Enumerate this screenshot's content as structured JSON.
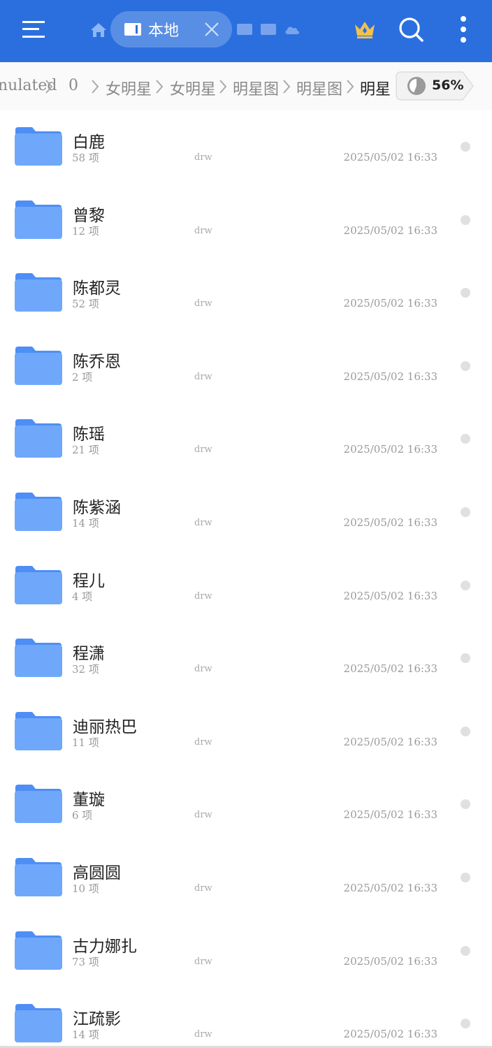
{
  "toolbar": {
    "active_tab_label": "本地",
    "icons": [
      "menu-icon",
      "home-icon",
      "device-icon",
      "close-icon",
      "vip-crown-icon",
      "search-icon",
      "more-vertical-icon"
    ]
  },
  "breadcrumb": {
    "items": [
      "nulated",
      "0",
      "女明星",
      "女明星",
      "明星图",
      "明星图",
      "明星"
    ]
  },
  "storage": {
    "percent_label": "56%",
    "percent": 56
  },
  "colors": {
    "topbar": "#2b6fde",
    "folder": "#6fa8fb",
    "folder_tab": "#4e8ef5"
  },
  "files": [
    {
      "name": "白鹿",
      "count": "58 项",
      "perm": "drw",
      "date": "2025/05/02 16:33"
    },
    {
      "name": "曾黎",
      "count": "12 项",
      "perm": "drw",
      "date": "2025/05/02 16:33"
    },
    {
      "name": "陈都灵",
      "count": "52 项",
      "perm": "drw",
      "date": "2025/05/02 16:33"
    },
    {
      "name": "陈乔恩",
      "count": "2 项",
      "perm": "drw",
      "date": "2025/05/02 16:33"
    },
    {
      "name": "陈瑶",
      "count": "21 项",
      "perm": "drw",
      "date": "2025/05/02 16:33"
    },
    {
      "name": "陈紫涵",
      "count": "14 项",
      "perm": "drw",
      "date": "2025/05/02 16:33"
    },
    {
      "name": "程儿",
      "count": "4 项",
      "perm": "drw",
      "date": "2025/05/02 16:33"
    },
    {
      "name": "程潇",
      "count": "32 项",
      "perm": "drw",
      "date": "2025/05/02 16:33"
    },
    {
      "name": "迪丽热巴",
      "count": "11 项",
      "perm": "drw",
      "date": "2025/05/02 16:33"
    },
    {
      "name": "董璇",
      "count": "6 项",
      "perm": "drw",
      "date": "2025/05/02 16:33"
    },
    {
      "name": "高圆圆",
      "count": "10 项",
      "perm": "drw",
      "date": "2025/05/02 16:33"
    },
    {
      "name": "古力娜扎",
      "count": "73 项",
      "perm": "drw",
      "date": "2025/05/02 16:33"
    },
    {
      "name": "江疏影",
      "count": "14 项",
      "perm": "drw",
      "date": "2025/05/02 16:33"
    }
  ]
}
